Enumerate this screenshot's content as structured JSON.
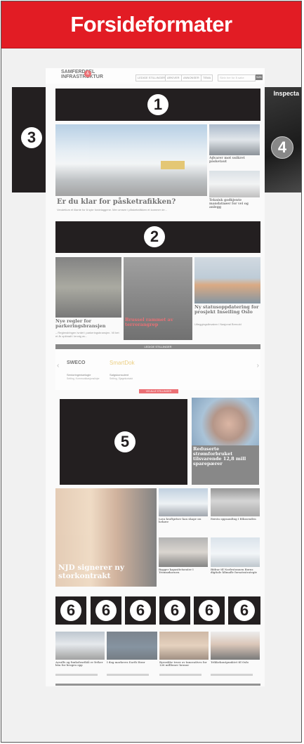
{
  "header": {
    "title": "Forsideformater"
  },
  "site": {
    "logo_top": "SAMFERDSEL",
    "logo_bottom": "INFRASTRUKTUR",
    "logo_mark": "&",
    "nav": [
      "LEDIGE STILLINGER",
      "ARKIVER",
      "ANNONSER",
      "TEMA"
    ],
    "search_placeholder": "Skriv her for å søke",
    "search_button": "SØK"
  },
  "markers": [
    "1",
    "2",
    "3",
    "4",
    "5",
    "6"
  ],
  "side_ad": {
    "brand": "Inspecta"
  },
  "top_story": {
    "headline": "Er du klar for påsketrafikken?",
    "sub": "Vendetium et illante for å syte fordelaggene. Mer omsen i påsketrafikken et kommer de..."
  },
  "top_right": [
    {
      "headline": "Advarer mot usikret påsketaut"
    },
    {
      "headline": "Teknisk godkjente mandatnøer for vei og anlegg"
    }
  ],
  "row2": [
    {
      "headline": "Nye regler for parkeringsbransjen",
      "sub": "– Reglendringen ivrdet i parkeringsbransjen. Vil bet et år optimalt i lennig av..."
    },
    {
      "headline": "Brussel rammet av terrorangrep"
    },
    {
      "headline": "Ny statusoppdatering for prosjekt Inseiling Oslo",
      "sub": "Utleggingsårsaken i Nasjonal Bernold"
    }
  ],
  "jobs": {
    "title": "LEDIGE STILLINGER",
    "items": [
      {
        "brand": "SWECO",
        "title": "Senioringeniørlogie",
        "sub": "Selting, Kommunikasjonslinjer"
      },
      {
        "brand": "SmartDok",
        "title": "Salgskonsulent",
        "sub": "Selting, Sjøgekontakt"
      }
    ],
    "button": "VIS ALLE STILLINGER"
  },
  "feature": {
    "headline": "Reduserte strømforbruket tilsvarende 12,8 mill sparepærer"
  },
  "grid": {
    "main_headline": "NJD signerer ny storkontrakt",
    "items": [
      {
        "headline": "Lava kraftpriser kan skape nu hehøve"
      },
      {
        "headline": "Førstn oppsamling i Rikssenden"
      },
      {
        "headline": "Bygger kapasitetsenter i Tromsøhavnen"
      },
      {
        "headline": "Bidrar til Norlestonnen Borns digitale klimafle forsatsstrategie"
      }
    ]
  },
  "bottom": [
    {
      "headline": "Arealfs og funkolosrikiå er fréker bån for brogen opp"
    },
    {
      "headline": "I dag markeres Earth Hour"
    },
    {
      "headline": "Ryenskke truer av innovatives for 126 millioner kronor"
    },
    {
      "headline": "Trikkeknutpunktet til Oslo"
    }
  ]
}
